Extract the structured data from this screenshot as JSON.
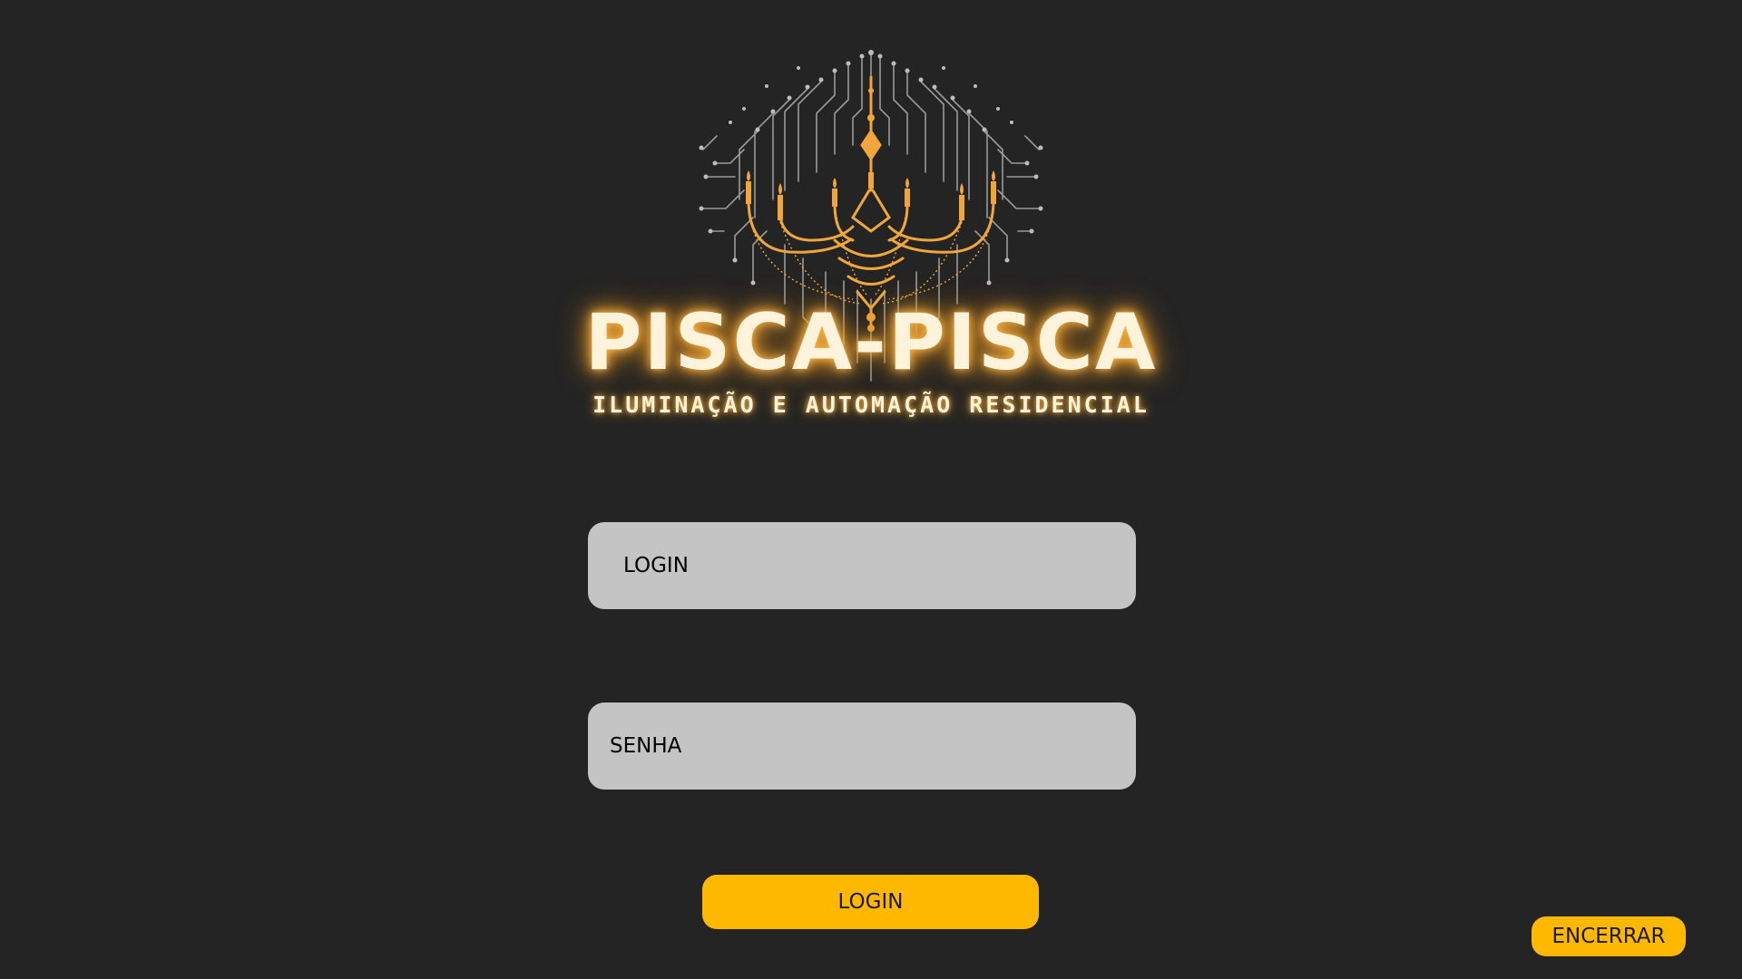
{
  "brand": {
    "title": "PISCA-PISCA",
    "subtitle": "ILUMINAÇÃO E AUTOMAÇÃO RESIDENCIAL",
    "logo_icon": "chandelier-circuit-icon",
    "glow_color": "#f3a531",
    "text_color": "#fff3dc"
  },
  "form": {
    "login_placeholder": "LOGIN",
    "login_value": "",
    "password_placeholder": "SENHA",
    "password_value": "",
    "submit_label": "LOGIN"
  },
  "footer": {
    "exit_label": "ENCERRAR"
  },
  "colors": {
    "background": "#242424",
    "field_background": "#c4c4c4",
    "accent": "#ffb800",
    "circuit_lines": "#9a9a9a",
    "chandelier_gold": "#f0a63a"
  }
}
